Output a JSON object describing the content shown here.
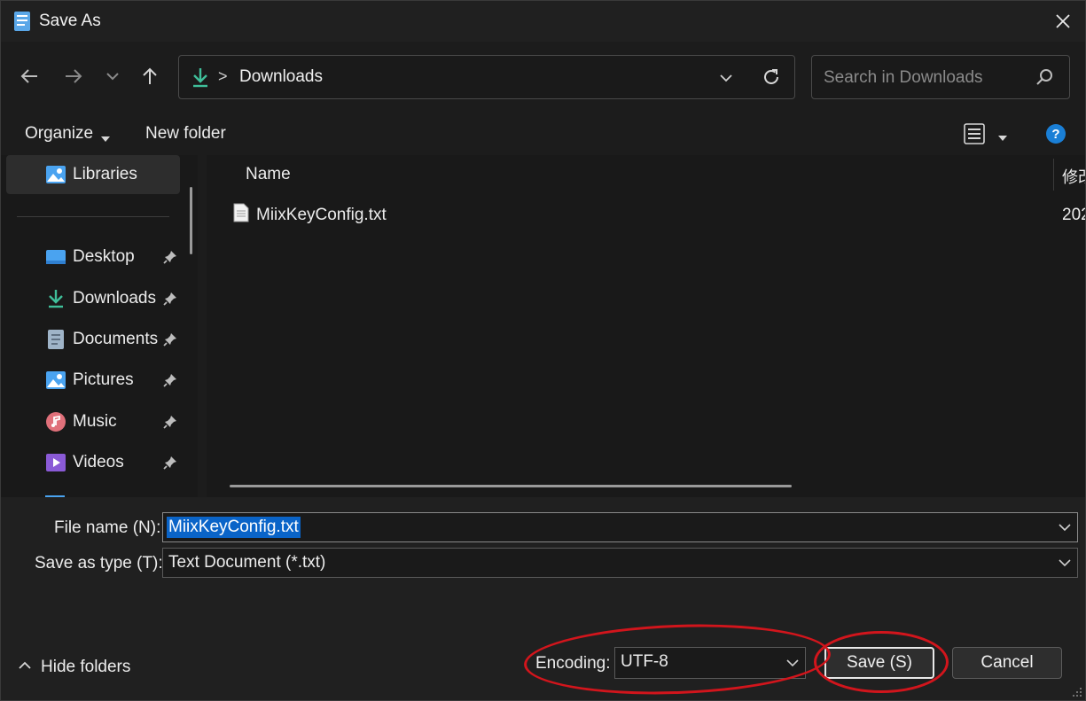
{
  "window": {
    "title": "Save As"
  },
  "nav": {
    "back_icon": "arrow-left-icon",
    "forward_icon": "arrow-right-icon",
    "recent_icon": "chevron-down-icon",
    "up_icon": "arrow-up-icon",
    "address": {
      "location_icon": "download-icon",
      "separator": ">",
      "path": "Downloads"
    },
    "search": {
      "placeholder": "Search in Downloads"
    }
  },
  "commandbar": {
    "organize": "Organize",
    "new_folder": "New folder"
  },
  "sidebar": {
    "items": [
      {
        "label": "Libraries",
        "icon": "libraries-icon",
        "selected": true,
        "pinned": false
      },
      {
        "label": "Desktop",
        "icon": "desktop-icon",
        "pinned": true
      },
      {
        "label": "Downloads",
        "icon": "download-icon",
        "pinned": true
      },
      {
        "label": "Documents",
        "icon": "documents-icon",
        "pinned": true
      },
      {
        "label": "Pictures",
        "icon": "pictures-icon",
        "pinned": true
      },
      {
        "label": "Music",
        "icon": "music-icon",
        "pinned": true
      },
      {
        "label": "Videos",
        "icon": "videos-icon",
        "pinned": true
      }
    ]
  },
  "filelist": {
    "columns": [
      "Name",
      "修改"
    ],
    "rows": [
      {
        "name": "MiixKeyConfig.txt",
        "modified": "202",
        "icon": "text-file-icon"
      }
    ]
  },
  "form": {
    "file_name_label": "File name (N):",
    "file_name_value": "MiixKeyConfig.txt",
    "save_type_label": "Save as type (T):",
    "save_type_value": "Text Document (*.txt)",
    "encoding_label": "Encoding:",
    "encoding_value": "UTF-8"
  },
  "footer": {
    "hide_folders": "Hide folders",
    "save_button": "Save (S)",
    "cancel_button": "Cancel"
  },
  "colors": {
    "background": "#1c1c1c",
    "selection": "#0a64c8",
    "annotation": "#d2151c",
    "help": "#1a7fd6",
    "download_green": "#3fbf9a"
  }
}
